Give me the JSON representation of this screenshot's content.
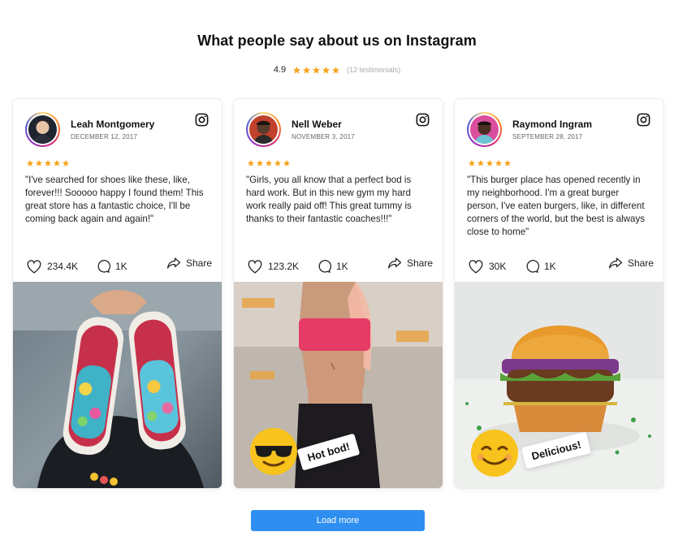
{
  "header": {
    "title": "What people say about us on Instagram",
    "rating": "4.9",
    "stars": 5,
    "testimonials": "(12 testimonials)"
  },
  "colors": {
    "star": "#f5a623",
    "button": "#2e8ff0",
    "text": "#111111"
  },
  "cards": [
    {
      "author": "Leah Montgomery",
      "date": "DECEMBER 12, 2017",
      "stars": 5,
      "quote": "\"I've searched for shoes like these, like, forever!!! Sooooo happy I found them! This great store has a fantastic choice, I'll be coming back again and again!\"",
      "likes": "234.4K",
      "comments": "1K",
      "share": "Share",
      "photo": "colorful-sneakers",
      "sticker": ""
    },
    {
      "author": "Nell Weber",
      "date": "NOVEMBER 3, 2017",
      "stars": 5,
      "quote": "\"Girls, you all know that a perfect bod is hard work. But in this new gym my hard work really paid off! This great tummy is thanks to their fantastic coaches!!!\"",
      "likes": "123.2K",
      "comments": "1K",
      "share": "Share",
      "photo": "fitness-woman",
      "sticker": "Hot bod!",
      "emoji": "sunglasses-emoji"
    },
    {
      "author": "Raymond Ingram",
      "date": "SEPTEMBER 28, 2017",
      "stars": 5,
      "quote": "\"This burger place has opened recently in my neighborhood. I'm a great burger person, I've eaten burgers, like, in different corners of the world, but the best is always close to home\"",
      "likes": "30K",
      "comments": "1K",
      "share": "Share",
      "photo": "burger",
      "sticker": "Delicious!",
      "emoji": "smiling-emoji"
    }
  ],
  "footer": {
    "load_more": "Load more"
  }
}
